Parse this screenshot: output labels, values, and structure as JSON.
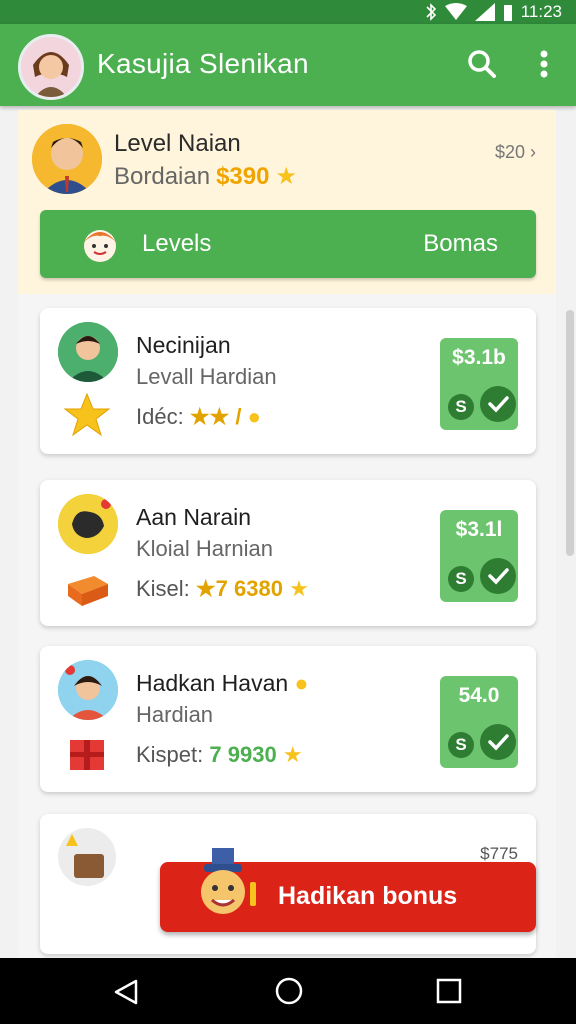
{
  "status_bar": {
    "time": "11:23"
  },
  "app_bar": {
    "title": "Kasujia Slenikan",
    "search_icon": "search-icon",
    "more_icon": "more-vert-icon"
  },
  "level_card": {
    "title": "Level Naian",
    "subtitle": "Bordaian",
    "amount": "$390",
    "link": "$20",
    "levels_label": "Levels",
    "bonus_label": "Bomas"
  },
  "list": [
    {
      "name": "Necinijan",
      "role": "Levall Hardian",
      "stats_label": "Idéc:",
      "stats_value": "★★ / ",
      "stats_tail": "",
      "badge": "$3.1b"
    },
    {
      "name": "Aan Narain",
      "role": "Kloial Harnian",
      "stats_label": "Kisel:",
      "stats_value": "★7 6380",
      "stats_tail": "★",
      "badge": "$3.1l"
    },
    {
      "name": "Hadkan Havan",
      "role": "Hardian",
      "stats_label": "Kispet:",
      "stats_value": "7 9930",
      "stats_tail": "★",
      "badge": "54.0"
    }
  ],
  "peek_card": {
    "amount": "$775"
  },
  "bonus_button": {
    "label": "Hadikan bonus"
  },
  "colors": {
    "primary": "#4caf50",
    "primary_dark": "#2f8a3a",
    "accent_red": "#db2318",
    "gold": "#f0a400"
  }
}
